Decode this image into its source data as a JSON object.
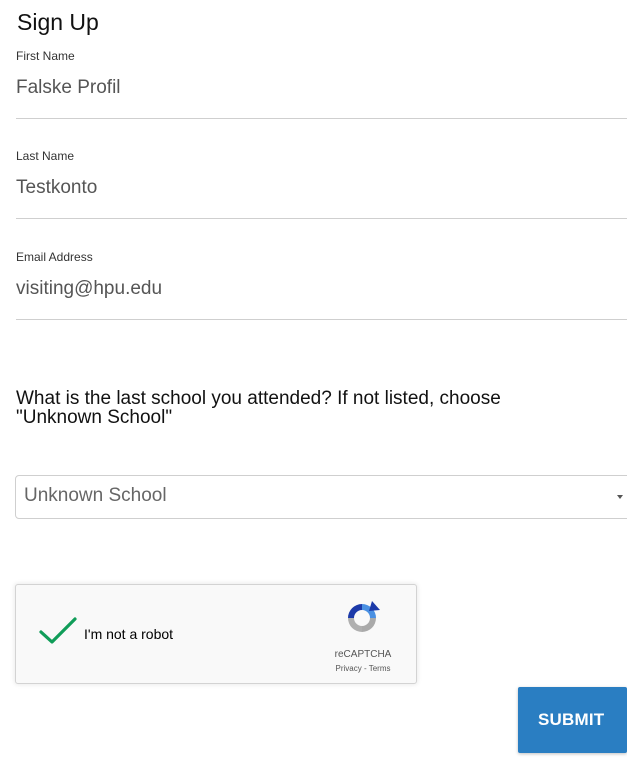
{
  "form": {
    "title": "Sign Up",
    "fields": [
      {
        "label": "First Name",
        "value": "Falske Profil"
      },
      {
        "label": "Last Name",
        "value": "Testkonto"
      },
      {
        "label": "Email Address",
        "value": "visiting@hpu.edu"
      }
    ],
    "school_question_line1": "What is the last school you attended? If not listed, choose",
    "school_question_line2": "\"Unknown School\"",
    "school_select_value": "Unknown School",
    "submit_label": "SUBMIT"
  },
  "captcha": {
    "label": "I'm not a robot",
    "brand": "reCAPTCHA",
    "privacy": "Privacy",
    "separator": " - ",
    "terms": "Terms",
    "checked": true
  },
  "colors": {
    "accent": "#2a7ec2",
    "check": "#109d59"
  },
  "icons": [
    "checkmark-icon",
    "recaptcha-logo-icon",
    "chevron-down-icon"
  ]
}
